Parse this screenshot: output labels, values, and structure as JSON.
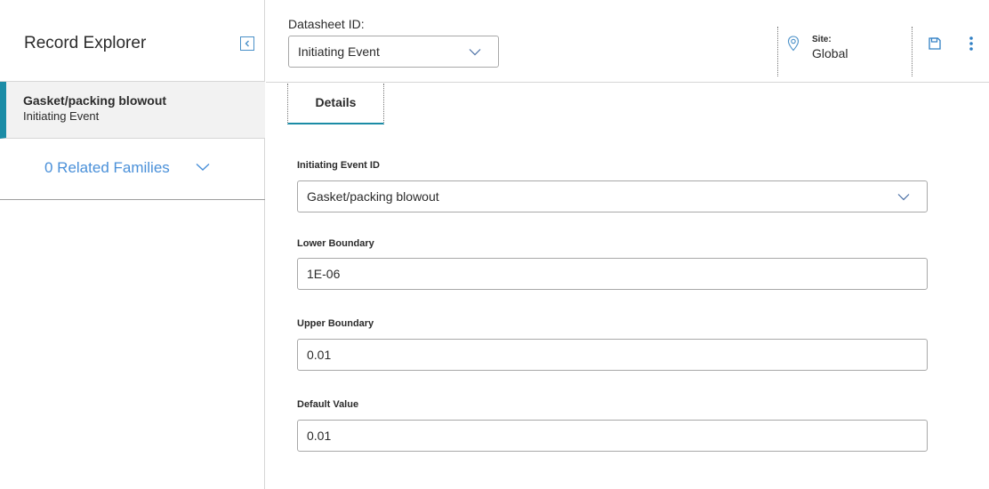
{
  "explorer": {
    "title": "Record Explorer",
    "collapse_icon": "chevron-left-icon"
  },
  "record": {
    "name": "Gasket/packing blowout",
    "type": "Initiating Event"
  },
  "related": {
    "label": "0 Related Families"
  },
  "datasheet": {
    "label": "Datasheet ID:",
    "value": "Initiating Event"
  },
  "site": {
    "label": "Site:",
    "value": "Global",
    "icon": "location-pin-icon"
  },
  "toolbar": {
    "save_icon": "save-icon",
    "more_icon": "more-vertical-icon"
  },
  "tabs": [
    {
      "label": "Details",
      "active": true
    }
  ],
  "form": {
    "fields": [
      {
        "label": "Initiating Event ID",
        "value": "Gasket/packing blowout",
        "kind": "select"
      },
      {
        "label": "Lower Boundary",
        "value": "1E-06",
        "kind": "text"
      },
      {
        "label": "Upper Boundary",
        "value": "0.01",
        "kind": "text"
      },
      {
        "label": "Default Value",
        "value": "0.01",
        "kind": "text"
      }
    ]
  },
  "colors": {
    "accent": "#1b8ca6",
    "link": "#4a90d9",
    "border": "#a8a8a8"
  }
}
